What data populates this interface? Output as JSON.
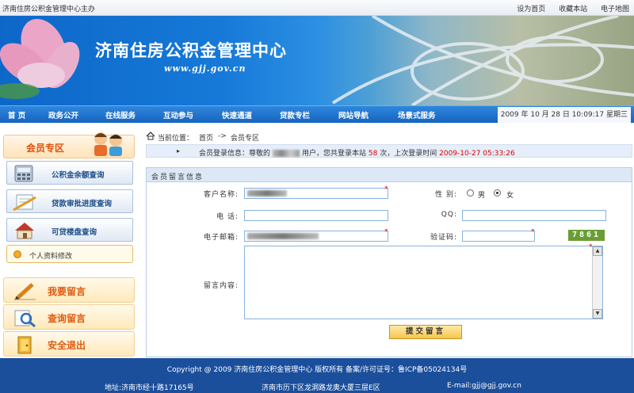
{
  "topbar": {
    "host_text": "济南住房公积金管理中心主办",
    "links": [
      "设为首页",
      "收藏本站",
      "电子地图"
    ]
  },
  "banner": {
    "title": "济南住房公积金管理中心",
    "url": "www.gjj.gov.cn"
  },
  "nav": {
    "items": [
      "首  页",
      "政务公开",
      "在线服务",
      "互动参与",
      "快速通道",
      "贷款专栏",
      "网站导航",
      "场景式服务"
    ],
    "datetime": "2009 年 10 月 28 日 10:09:17 星期三"
  },
  "sidebar": {
    "member_title": "会员专区",
    "quick_links": [
      "公积金余额查询",
      "贷款审批进度查询",
      "可贷楼盘查询"
    ],
    "profile_label": "个人资料修改",
    "big_buttons": [
      "我要留言",
      "查询留言",
      "安全退出"
    ]
  },
  "breadcrumb": {
    "prefix": "当前位置：",
    "home": "首页",
    "sep": "->",
    "current": "会员专区"
  },
  "login_info": {
    "arrow": "▸",
    "prefix": "会员登录信息：尊敬的",
    "mid": "用户，您共登录本站",
    "count": "58",
    "mid2": "次，上次登录时间",
    "last_login": "2009-10-27 05:33:26"
  },
  "form": {
    "header": "会员留言信息",
    "name_label": "客户名称:",
    "gender_label": "性 别:",
    "gender_male": "男",
    "gender_female": "女",
    "gender_selected": "女",
    "phone_label": "电    话:",
    "qq_label": "QQ:",
    "email_label": "电子邮箱:",
    "captcha_label": "验证码:",
    "captcha_value": "7861",
    "message_label": "留言内容:",
    "required_mark": "*",
    "submit_label": "提交留言"
  },
  "footer": {
    "copyright": "Copyright @ 2009 济南住房公积金管理中心 版权所有 备案/许可证号：鲁ICP备05024134号",
    "address1": "地址:济南市经十路17165号",
    "address2": "济南市历下区龙洞路龙奥大厦三层E区",
    "email": "E-mail:gjj@gjj.gov.cn"
  },
  "colors": {
    "nav_blue": "#1b6fcc",
    "accent_orange": "#e05a10",
    "footer_blue": "#1b4f9c",
    "captcha_green": "#6a9e34"
  }
}
